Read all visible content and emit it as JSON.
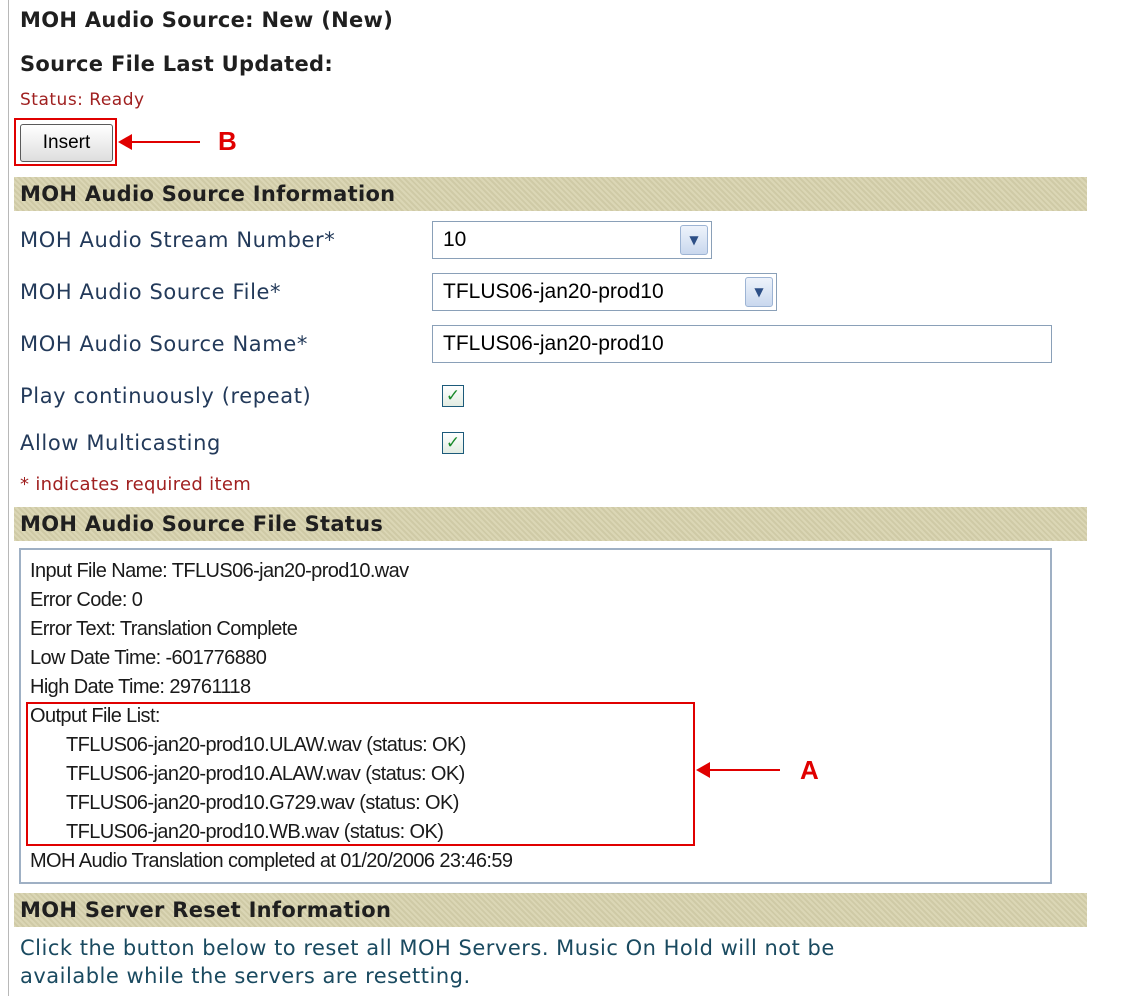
{
  "header": {
    "title": "MOH Audio Source:  New (New)",
    "last_updated_label": "Source File Last Updated:",
    "status_text": "Status:  Ready"
  },
  "toolbar": {
    "insert_label": "Insert"
  },
  "callouts": {
    "a": "A",
    "b": "B"
  },
  "info_section": {
    "title": "MOH Audio Source Information",
    "stream_number": {
      "label": "MOH Audio Stream Number*",
      "value": "10"
    },
    "source_file": {
      "label": "MOH Audio Source File*",
      "value": "TFLUS06-jan20-prod10"
    },
    "source_name": {
      "label": "MOH Audio Source Name*",
      "value": "TFLUS06-jan20-prod10"
    },
    "play_continuously": {
      "label": "Play continuously (repeat)",
      "checked": true
    },
    "allow_multicasting": {
      "label": "Allow Multicasting",
      "checked": true
    },
    "required_note": "* indicates required item"
  },
  "file_status": {
    "title": "MOH Audio Source File Status",
    "lines": [
      "Input File Name: TFLUS06-jan20-prod10.wav",
      "Error Code: 0",
      "Error Text: Translation Complete",
      "Low Date Time: -601776880",
      "High Date Time: 29761118",
      "Output File List:",
      "TFLUS06-jan20-prod10.ULAW.wav (status: OK)",
      "TFLUS06-jan20-prod10.ALAW.wav (status: OK)",
      "TFLUS06-jan20-prod10.G729.wav (status: OK)",
      "TFLUS06-jan20-prod10.WB.wav (status: OK)",
      "MOH Audio Translation completed at 01/20/2006 23:46:59"
    ]
  },
  "reset_section": {
    "title": "MOH Server Reset Information",
    "line1": "Click the button below to reset all MOH Servers. Music On Hold will not be",
    "line2": "available while the servers are resetting."
  },
  "colors": {
    "section_bar": "#d7d2ad",
    "callout_red": "#e00000",
    "status_red": "#a02020",
    "label_blue": "#233a5a"
  },
  "icons": {
    "dropdown": "chevron-down-icon",
    "check": "checkmark-icon"
  }
}
